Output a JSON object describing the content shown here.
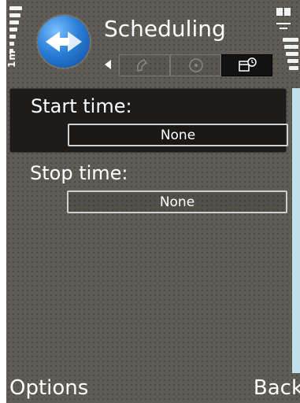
{
  "status": {
    "signal_label": "1m"
  },
  "header": {
    "title": "Scheduling",
    "tabs": [
      {
        "name": "call",
        "icon": "phone-icon"
      },
      {
        "name": "settings",
        "icon": "target-icon"
      },
      {
        "name": "scheduling",
        "icon": "calendar-clock-icon",
        "active": true
      }
    ]
  },
  "settings": [
    {
      "label": "Start time:",
      "value": "None",
      "selected": true
    },
    {
      "label": "Stop time:",
      "value": "None",
      "selected": false
    }
  ],
  "softkeys": {
    "left": "Options",
    "right": "Back"
  },
  "colors": {
    "background": "#5f5c55",
    "selected_row": "#1d1c1a",
    "scrollbar": "#bfe0ec",
    "icon_blue": "#2a7fd8"
  }
}
